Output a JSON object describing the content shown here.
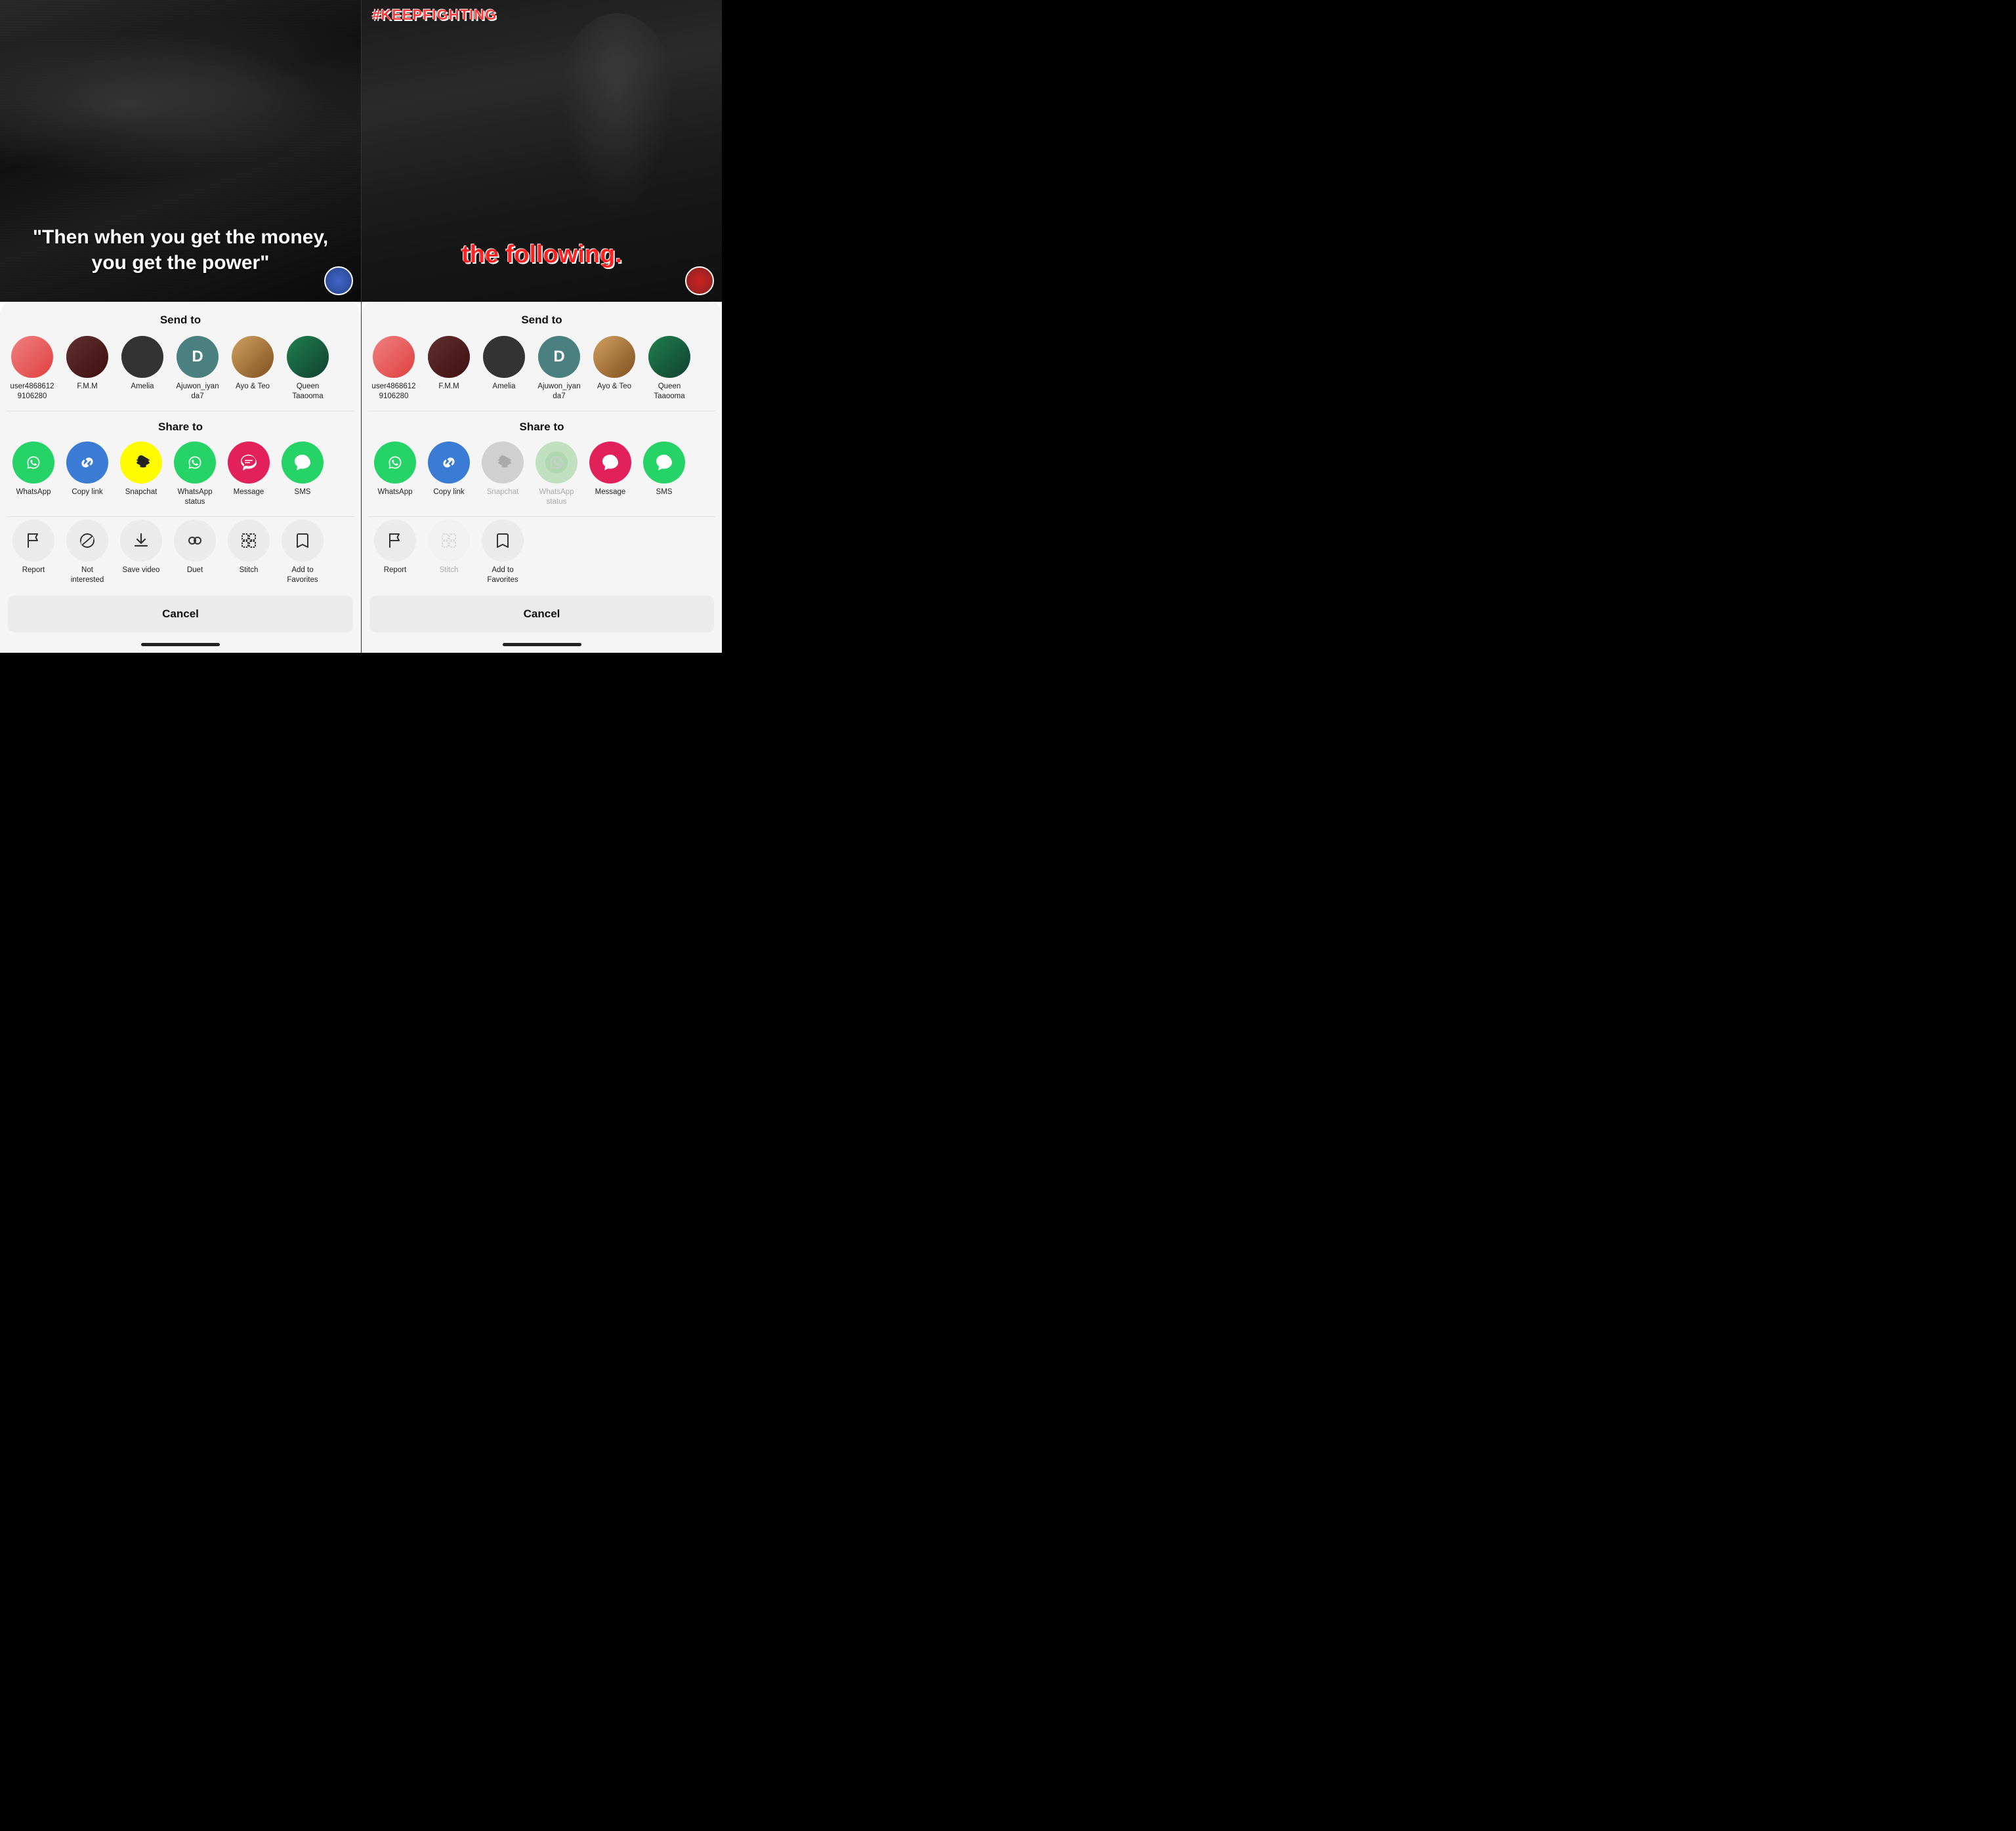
{
  "panel_left": {
    "video": {
      "text": "\"Then when you get the money, you get the power\""
    },
    "send_to_title": "Send to",
    "contacts": [
      {
        "id": "user486868129106280",
        "label": "user4868612\n9106280",
        "color": "av-pink",
        "initials": ""
      },
      {
        "id": "fmm",
        "label": "F.M.M",
        "color": "av-photo2",
        "initials": ""
      },
      {
        "id": "amelia",
        "label": "Amelia",
        "color": "av-dark",
        "initials": ""
      },
      {
        "id": "ajuwon",
        "label": "Ajuwon_iyan\nda7",
        "color": "av-teal",
        "initials": "D"
      },
      {
        "id": "ayo_teo",
        "label": "Ayo & Teo",
        "color": "av-photo3",
        "initials": ""
      },
      {
        "id": "queen",
        "label": "Queen\nTaaooma",
        "color": "av-photo4",
        "initials": ""
      }
    ],
    "share_to_title": "Share to",
    "share_items": [
      {
        "id": "whatsapp",
        "label": "WhatsApp",
        "bg": "bg-whatsapp",
        "icon": "💬",
        "disabled": false
      },
      {
        "id": "copy_link",
        "label": "Copy link",
        "bg": "bg-copylink",
        "icon": "🔗",
        "disabled": false
      },
      {
        "id": "snapchat",
        "label": "Snapchat",
        "bg": "bg-snapchat",
        "icon": "👻",
        "disabled": false
      },
      {
        "id": "wa_status",
        "label": "WhatsApp status",
        "bg": "bg-wastatus",
        "icon": "💬",
        "disabled": false
      },
      {
        "id": "message",
        "label": "Message",
        "bg": "bg-message",
        "icon": "▽",
        "disabled": false
      },
      {
        "id": "sms",
        "label": "SMS",
        "bg": "bg-sms",
        "icon": "💬",
        "disabled": false
      }
    ],
    "actions": [
      {
        "id": "report",
        "label": "Report",
        "icon": "⚑",
        "disabled": false
      },
      {
        "id": "not_interested",
        "label": "Not\ninterested",
        "icon": "🤍",
        "disabled": false
      },
      {
        "id": "save_video",
        "label": "Save video",
        "icon": "↓",
        "disabled": false
      },
      {
        "id": "duet",
        "label": "Duet",
        "icon": "◎",
        "disabled": false
      },
      {
        "id": "stitch",
        "label": "Stitch",
        "icon": "⊞",
        "disabled": false
      },
      {
        "id": "add_favorites",
        "label": "Add to\nFavorites",
        "icon": "🔖",
        "disabled": false
      }
    ],
    "cancel_label": "Cancel"
  },
  "panel_right": {
    "video": {
      "tag": "#KEEPFIGHTING",
      "subtitle": "the following."
    },
    "send_to_title": "Send to",
    "contacts": [
      {
        "id": "user486868129106280",
        "label": "user4868612\n9106280",
        "color": "av-pink",
        "initials": ""
      },
      {
        "id": "fmm",
        "label": "F.M.M",
        "color": "av-photo2",
        "initials": ""
      },
      {
        "id": "amelia",
        "label": "Amelia",
        "color": "av-dark",
        "initials": ""
      },
      {
        "id": "ajuwon",
        "label": "Ajuwon_iyan\nda7",
        "color": "av-teal",
        "initials": "D"
      },
      {
        "id": "ayo_teo",
        "label": "Ayo & Teo",
        "color": "av-photo3",
        "initials": ""
      },
      {
        "id": "queen",
        "label": "Queen\nTaaooma",
        "color": "av-photo4",
        "initials": ""
      }
    ],
    "share_to_title": "Share to",
    "share_items": [
      {
        "id": "whatsapp",
        "label": "WhatsApp",
        "bg": "bg-whatsapp",
        "icon": "💬",
        "disabled": false
      },
      {
        "id": "copy_link",
        "label": "Copy link",
        "bg": "bg-copylink",
        "icon": "🔗",
        "disabled": false
      },
      {
        "id": "snapchat",
        "label": "Snapchat",
        "bg": "bg-snapchat-grey",
        "icon": "👻",
        "disabled": true
      },
      {
        "id": "wa_status",
        "label": "WhatsApp\nstatus",
        "bg": "bg-wastatus-grey",
        "icon": "💬",
        "disabled": true
      },
      {
        "id": "message",
        "label": "Message",
        "bg": "bg-message",
        "icon": "▽",
        "disabled": false
      },
      {
        "id": "sms",
        "label": "SMS",
        "bg": "bg-sms",
        "icon": "💬",
        "disabled": false
      }
    ],
    "actions": [
      {
        "id": "report",
        "label": "Report",
        "icon": "⚑",
        "disabled": false
      },
      {
        "id": "stitch",
        "label": "Stitch",
        "icon": "⊞",
        "disabled": true
      },
      {
        "id": "add_favorites",
        "label": "Add to\nFavorites",
        "icon": "🔖",
        "disabled": false
      }
    ],
    "cancel_label": "Cancel"
  }
}
